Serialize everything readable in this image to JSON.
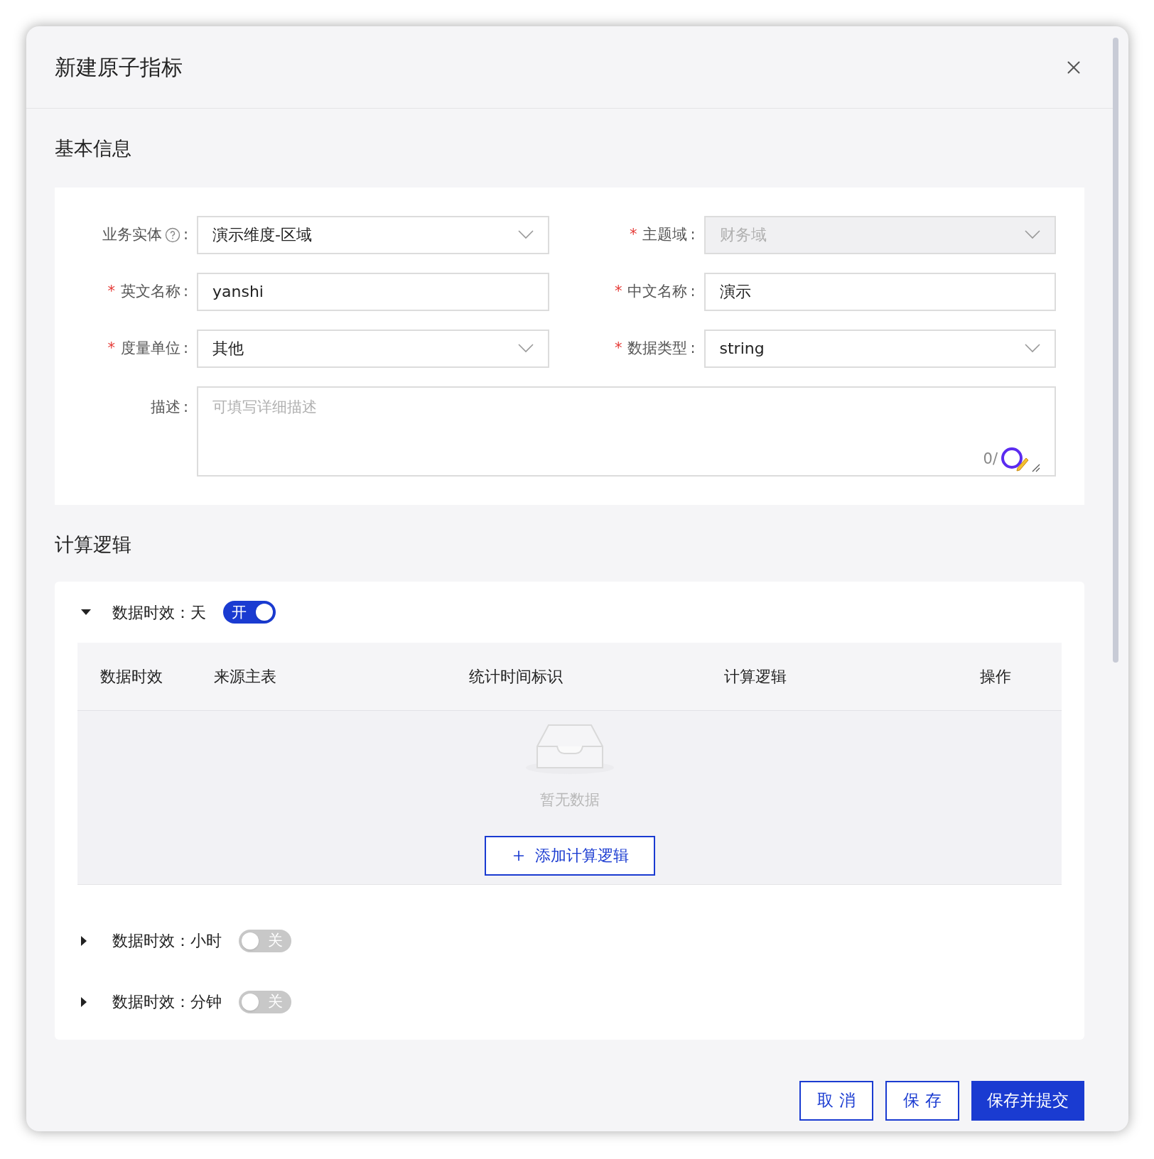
{
  "dialog": {
    "title": "新建原子指标"
  },
  "basic_info": {
    "title": "基本信息",
    "fields": [
      {
        "label": "业务实体",
        "help": true,
        "colon": ":",
        "kind": "select",
        "value": "演示维度-区域",
        "disabled": false
      },
      {
        "required_mark": "*",
        "label": "主题域",
        "colon": ":",
        "kind": "select",
        "value": "财务域",
        "disabled": true
      },
      {
        "required_mark": "*",
        "label": "英文名称",
        "colon": ":",
        "kind": "input",
        "value": "yanshi",
        "disabled": false
      },
      {
        "required_mark": "*",
        "label": "中文名称",
        "colon": ":",
        "kind": "input",
        "value": "演示",
        "disabled": false
      },
      {
        "required_mark": "*",
        "label": "度量单位",
        "colon": ":",
        "kind": "select",
        "value": "其他",
        "disabled": false
      },
      {
        "required_mark": "*",
        "label": "数据类型",
        "colon": ":",
        "kind": "select",
        "value": "string",
        "disabled": false
      }
    ],
    "description": {
      "label": "描述",
      "colon": ":",
      "placeholder": "可填写详细描述",
      "counter": "0/"
    }
  },
  "calc_logic": {
    "title": "计算逻辑",
    "groups": [
      {
        "label": "数据时效：天",
        "expanded": true,
        "on": true,
        "switch_text": "开",
        "table": {
          "columns": [
            "数据时效",
            "来源主表",
            "统计时间标识",
            "计算逻辑",
            "操作"
          ],
          "empty_text": "暂无数据",
          "add_button": "添加计算逻辑"
        }
      },
      {
        "label": "数据时效：小时",
        "expanded": false,
        "on": false,
        "switch_text": "关"
      },
      {
        "label": "数据时效：分钟",
        "expanded": false,
        "on": false,
        "switch_text": "关"
      }
    ]
  },
  "buttons": [
    {
      "label": "取 消",
      "kind": "outline"
    },
    {
      "label": "保 存",
      "kind": "outline"
    },
    {
      "label": "保存并提交",
      "kind": "primary"
    }
  ]
}
